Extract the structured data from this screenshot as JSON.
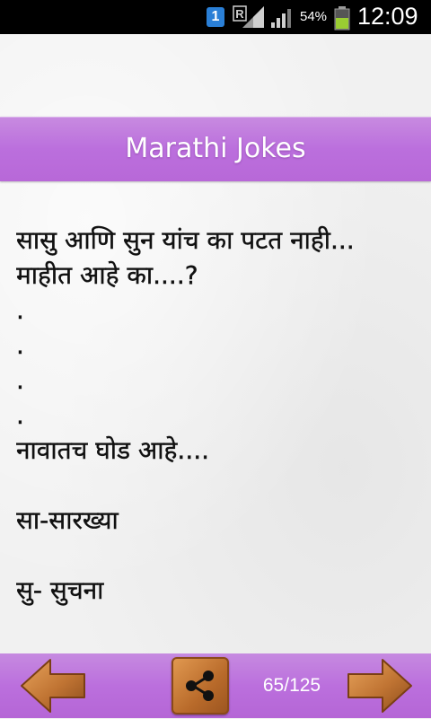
{
  "status_bar": {
    "notification_badge": "1",
    "roaming_indicator": "R",
    "battery_percent": "54%",
    "time": "12:09",
    "icons": [
      "notification-icon",
      "roaming-signal-icon",
      "signal-icon",
      "battery-icon"
    ]
  },
  "app": {
    "title": "Marathi Jokes"
  },
  "joke": {
    "lines": [
      "सासु आणि सुन यांच का पटत नाही...",
      "माहीत आहे का....?",
      ".",
      ".",
      ".",
      ".",
      "नावातच घोड आहे....",
      "",
      "सा-सारख्या",
      "",
      "सु- सुचना"
    ]
  },
  "nav": {
    "counter": "65/125",
    "prev_icon": "arrow-left-icon",
    "next_icon": "arrow-right-icon",
    "share_icon": "share-icon"
  },
  "colors": {
    "band": "#bb6fdd",
    "wood": "#c47a38",
    "status_bar": "#000000"
  }
}
